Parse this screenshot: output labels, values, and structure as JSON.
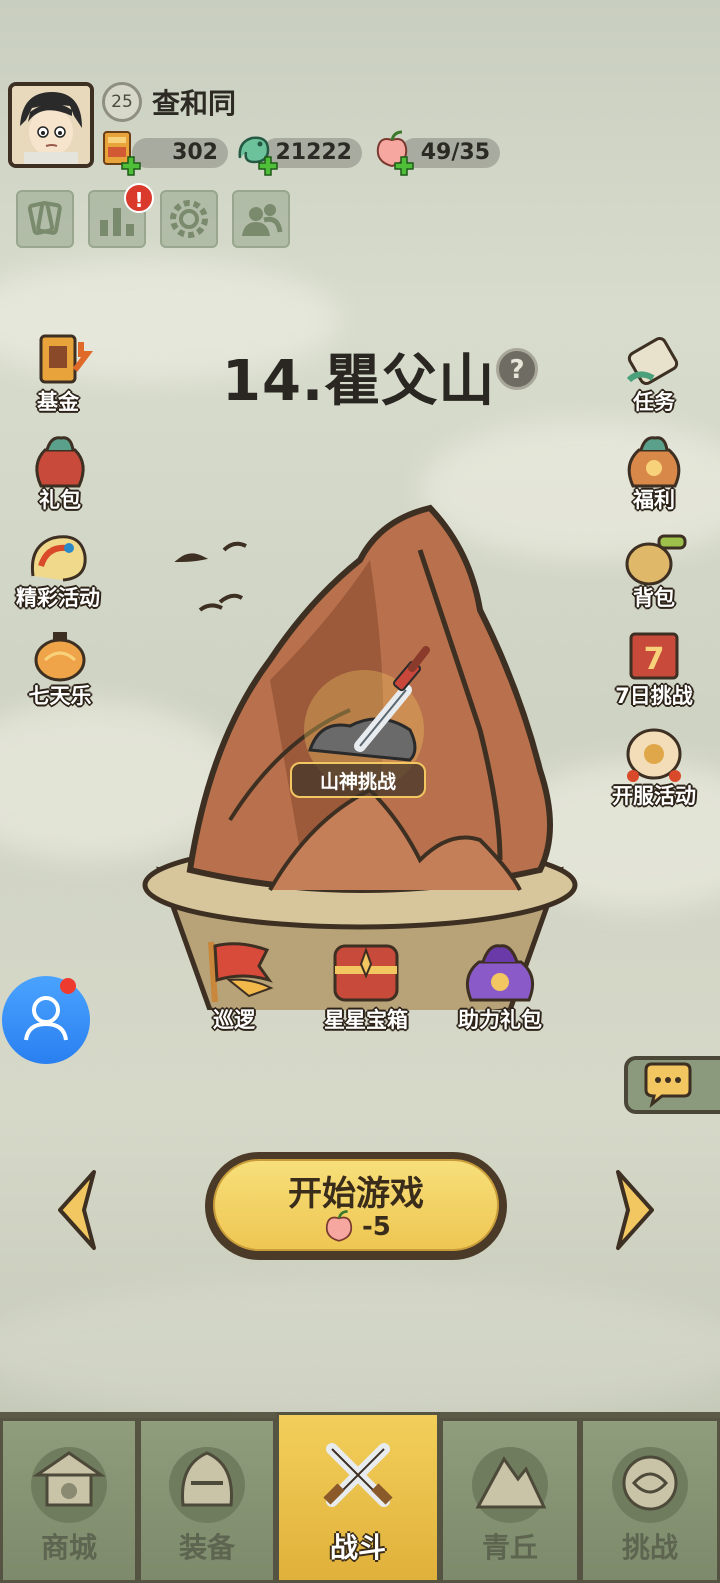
{
  "player": {
    "name": "查和同",
    "level": "25"
  },
  "resources": [
    {
      "icon": "scroll-ticket-icon",
      "value": "302"
    },
    {
      "icon": "jade-dragon-icon",
      "value": "21222"
    },
    {
      "icon": "peach-stamina-icon",
      "value": "49/35"
    }
  ],
  "toolbar": {
    "items": [
      "cards-icon",
      "ranking-icon",
      "settings-gear-icon",
      "friends-icon"
    ],
    "alert": "!"
  },
  "stage": {
    "title": "14.瞿父山",
    "help": "?",
    "challenge": "山神挑战"
  },
  "left_menu": [
    "基金",
    "礼包",
    "精彩活动",
    "七天乐"
  ],
  "right_menu": [
    "任务",
    "福利",
    "背包",
    "7日挑战",
    "开服活动"
  ],
  "stage_actions": [
    "巡逻",
    "星星宝箱",
    "助力礼包"
  ],
  "start": {
    "label": "开始游戏",
    "cost": "-5"
  },
  "tabs": [
    "商城",
    "装备",
    "战斗",
    "青丘",
    "挑战"
  ],
  "active_tab": "战斗",
  "colors": {
    "accent": "#eec652",
    "tab": "#8f9d7c",
    "text_dark": "#2a2722"
  }
}
